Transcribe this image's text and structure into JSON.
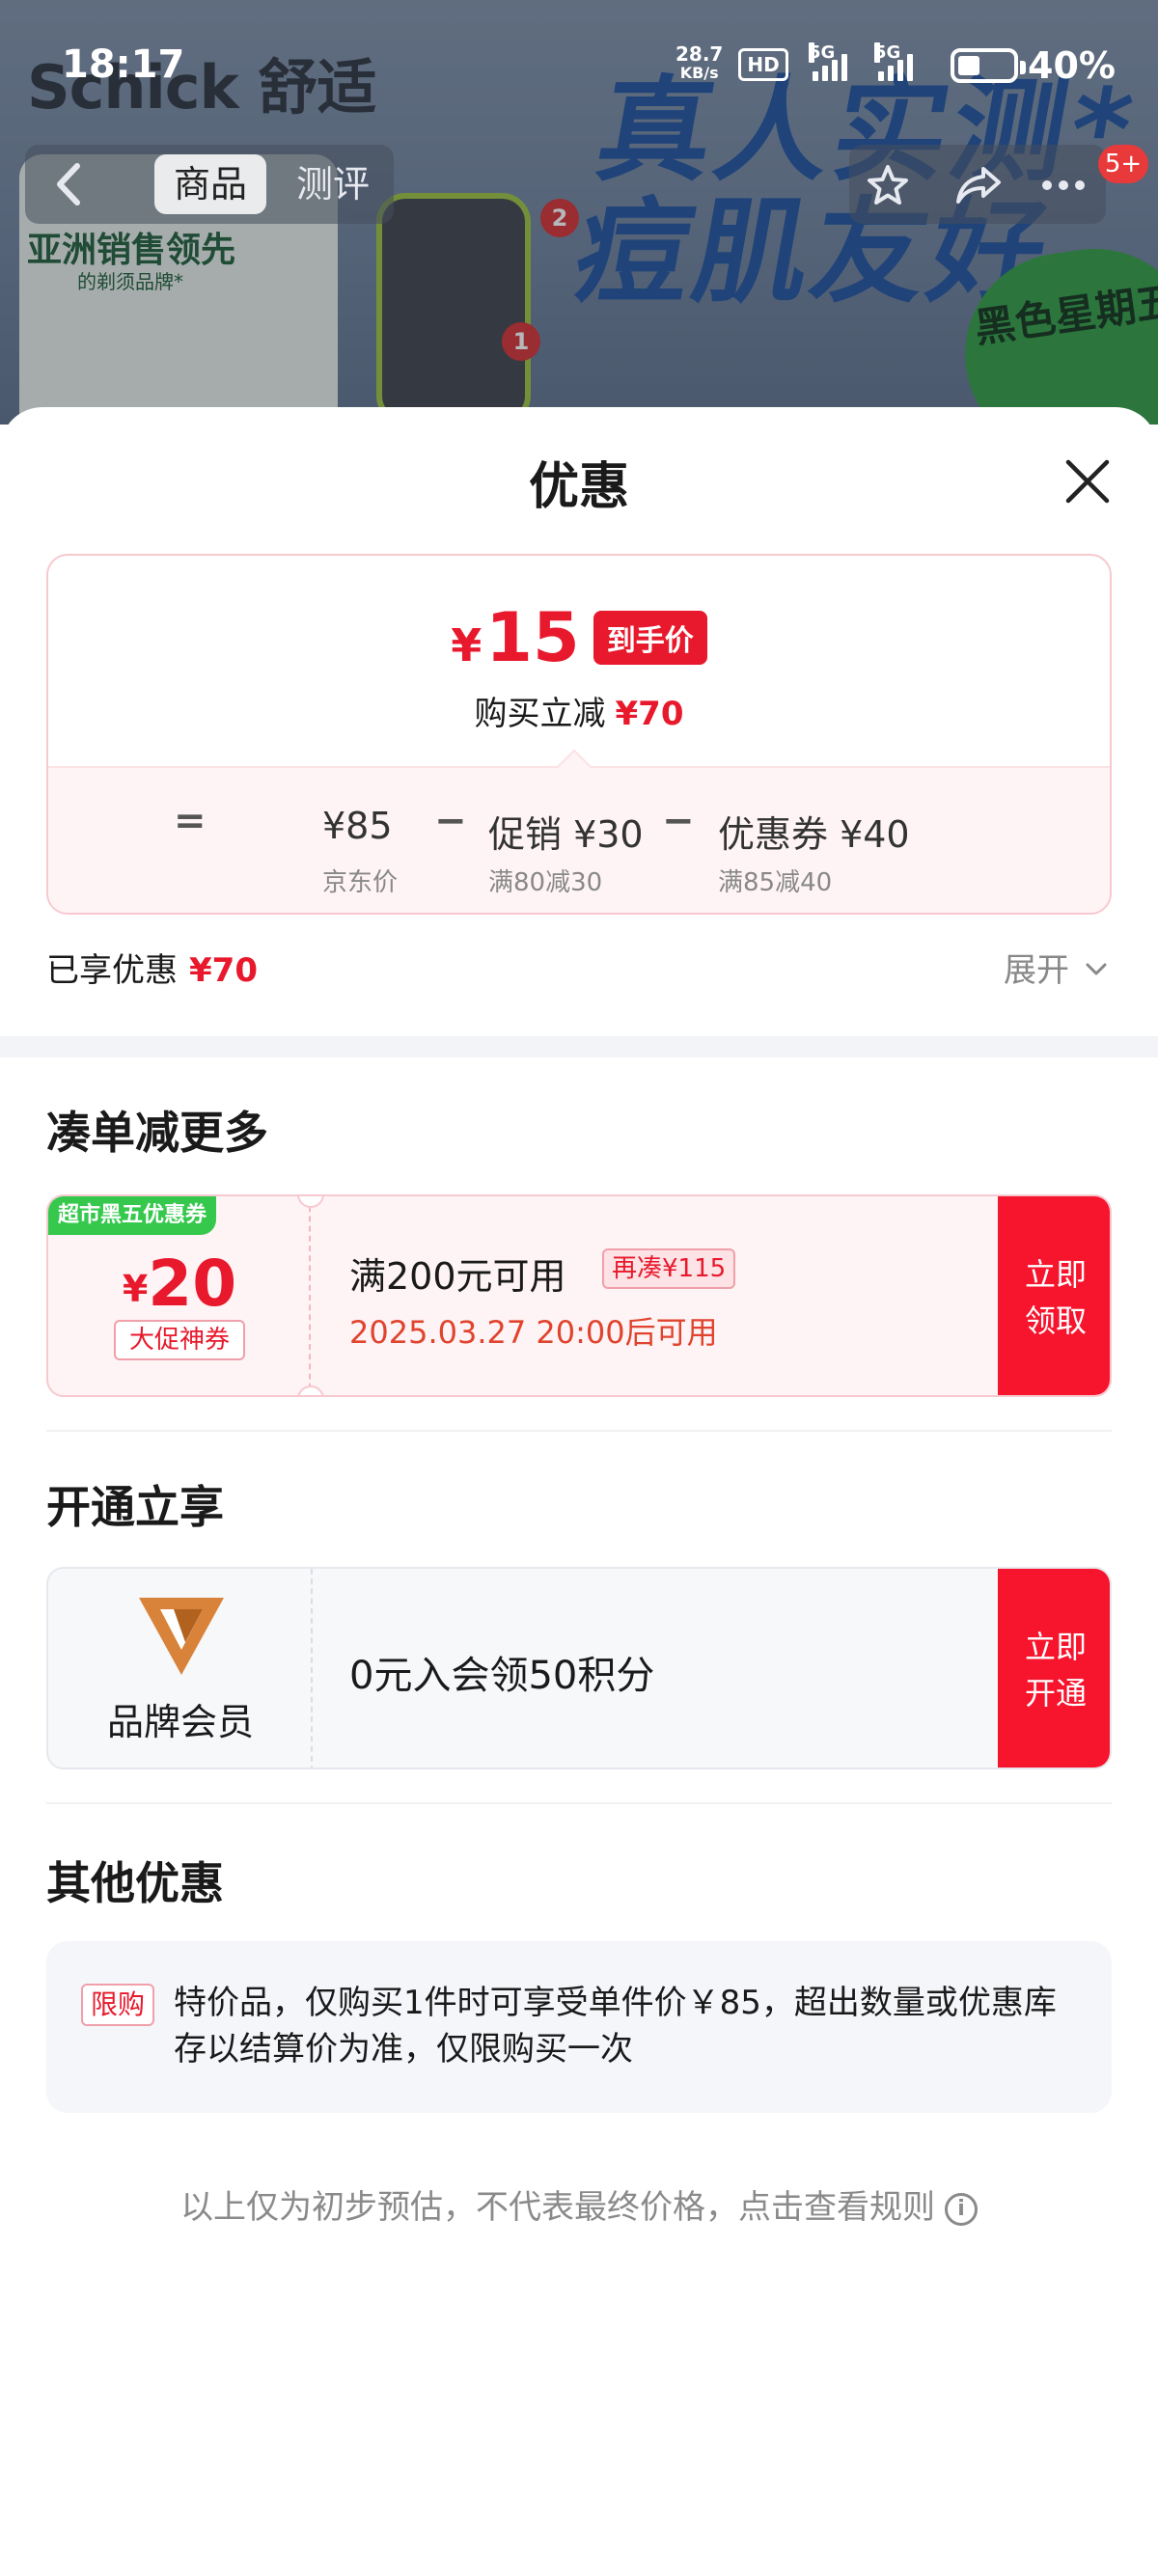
{
  "status_bar": {
    "time": "18:17",
    "net_speed_value": "28.7",
    "net_speed_unit": "KB/s",
    "hd_label": "HD",
    "signal1_label": "5G",
    "signal2_label": "5G",
    "battery_percent": "40%",
    "battery_level": 0.4
  },
  "banner": {
    "brand": "Schick 舒适",
    "slogan": "真人实测*痘肌友好",
    "badge": "黑色星期五",
    "product_text_1": "亚洲销售领先",
    "product_text_2": "的剃须品牌*"
  },
  "nav": {
    "tab_active": "商品",
    "tab_inactive": "测评",
    "messages_badge": "5+",
    "icons": [
      "back-icon",
      "star-icon",
      "share-icon",
      "more-icon"
    ]
  },
  "sheet": {
    "title": "优惠",
    "price": {
      "currency": "¥",
      "final_price": "15",
      "final_tag": "到手价",
      "reduce_label": "购买立减",
      "reduce_value": "¥70",
      "equals": "=",
      "minus": "−",
      "jd_price": "¥85",
      "jd_price_label": "京东价",
      "promo": "促销 ¥30",
      "promo_rule": "满80减30",
      "coupon": "优惠券 ¥40",
      "coupon_rule": "满85减40"
    },
    "enjoyed_label": "已享优惠",
    "enjoyed_value": "¥70",
    "expand_label": "展开",
    "section_more": "凑单减更多",
    "coupon": {
      "ribbon": "超市黑五优惠券",
      "currency": "¥",
      "amount": "20",
      "kind": "大促神券",
      "condition": "满200元可用",
      "gap": "再凑¥115",
      "time": "2025.03.27 20:00后可用",
      "btn_line1": "立即",
      "btn_line2": "领取"
    },
    "section_member": "开通立享",
    "member": {
      "label": "品牌会员",
      "text": "0元入会领50积分",
      "btn_line1": "立即",
      "btn_line2": "开通"
    },
    "section_other": "其他优惠",
    "other": {
      "tag": "限购",
      "text": "特价品，仅购买1件时可享受单件价￥85，超出数量或优惠库存以结算价为准，仅限购买一次"
    },
    "footer": "以上仅为初步预估，不代表最终价格，点击查看规则"
  },
  "colors": {
    "accent_red": "#e8192c",
    "button_red": "#f7142d",
    "coupon_green": "#35c84d",
    "member_orange": "#d9833a"
  }
}
